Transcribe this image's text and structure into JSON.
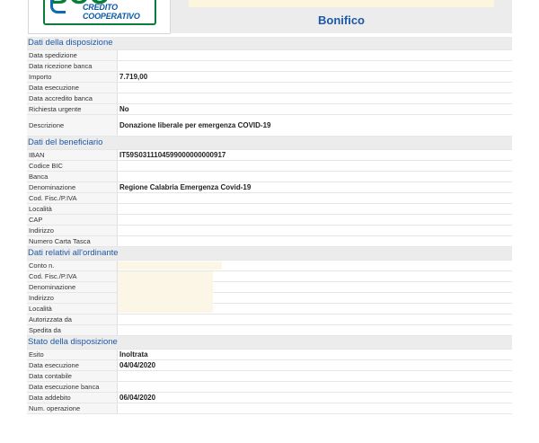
{
  "header": {
    "logo_text": "CREDITO COOPERATIVO",
    "logo_letters": "BCC",
    "title": "Bonifico"
  },
  "sections": [
    {
      "title": "Dati della disposizione",
      "rows": [
        {
          "label": "Data spedizione",
          "value": ""
        },
        {
          "label": "Data ricezione banca",
          "value": ""
        },
        {
          "label": "Importo",
          "value": "7.719,00"
        },
        {
          "label": "Data esecuzione",
          "value": ""
        },
        {
          "label": "Data accredito banca",
          "value": ""
        },
        {
          "label": "Richiesta urgente",
          "value": "No"
        },
        {
          "label": "Descrizione",
          "value": "Donazione liberale per emergenza COVID-19"
        }
      ]
    },
    {
      "title": "Dati del beneficiario",
      "rows": [
        {
          "label": "IBAN",
          "value": "IT59S0311104599000000000917"
        },
        {
          "label": "Codice BIC",
          "value": ""
        },
        {
          "label": "Banca",
          "value": ""
        },
        {
          "label": "Denominazione",
          "value": "Regione Calabria Emergenza Covid-19"
        },
        {
          "label": "Cod. Fisc./P.IVA",
          "value": ""
        },
        {
          "label": "Località",
          "value": ""
        },
        {
          "label": "CAP",
          "value": ""
        },
        {
          "label": "Indirizzo",
          "value": ""
        },
        {
          "label": "Numero Carta Tasca",
          "value": ""
        }
      ]
    },
    {
      "title": "Dati relativi all'ordinante",
      "rows": [
        {
          "label": "Conto n.",
          "value": ""
        },
        {
          "label": "Cod. Fisc./P.IVA",
          "value": ""
        },
        {
          "label": "Denominazione",
          "value": ""
        },
        {
          "label": "Indirizzo",
          "value": ""
        },
        {
          "label": "Località",
          "value": ""
        },
        {
          "label": "Autorizzata da",
          "value": ""
        },
        {
          "label": "Spedita da",
          "value": ""
        }
      ]
    },
    {
      "title": "Stato della disposizione",
      "rows": [
        {
          "label": "Esito",
          "value": "Inoltrata"
        },
        {
          "label": "Data esecuzione",
          "value": "04/04/2020"
        },
        {
          "label": "Data contabile",
          "value": ""
        },
        {
          "label": "Data esecuzione banca",
          "value": ""
        },
        {
          "label": "Data addebito",
          "value": "06/04/2020"
        },
        {
          "label": "Num. operazione",
          "value": ""
        }
      ]
    }
  ]
}
